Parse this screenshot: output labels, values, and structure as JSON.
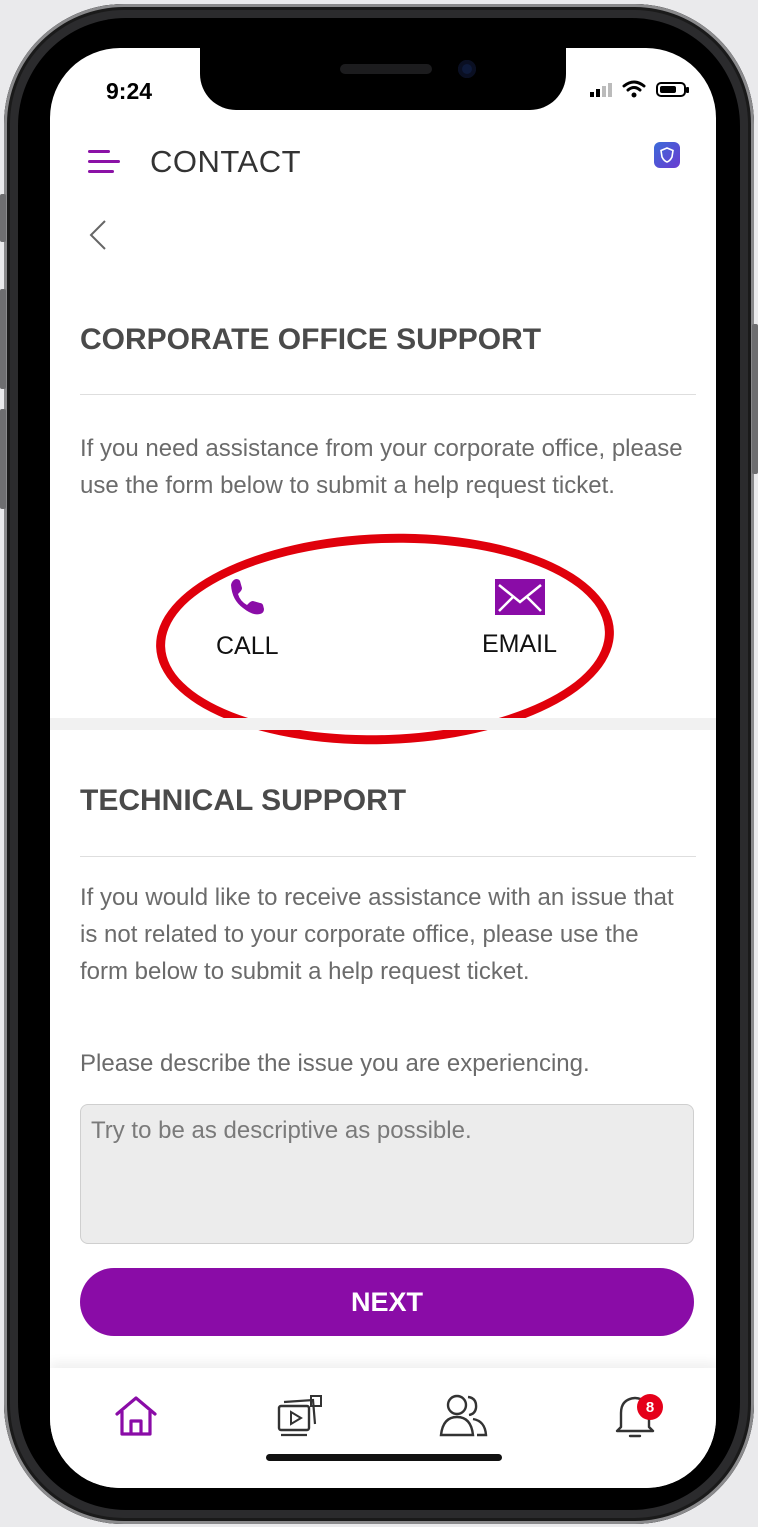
{
  "status_bar": {
    "time": "9:24"
  },
  "header": {
    "title": "CONTACT"
  },
  "corporate": {
    "heading": "CORPORATE OFFICE SUPPORT",
    "description": "If you need assistance from your corporate office, please use the form below to submit a help request ticket.",
    "call_label": "CALL",
    "email_label": "EMAIL"
  },
  "technical": {
    "heading": "TECHNICAL SUPPORT",
    "description": "If you would like to receive assistance with an issue that is not related to your corporate office, please use the form below to submit a help request ticket.",
    "prompt": "Please describe the issue you are experiencing.",
    "textarea_placeholder": "Try to be as descriptive as possible.",
    "next_label": "NEXT"
  },
  "tabbar": {
    "items": [
      {
        "icon": "home-icon",
        "active": true
      },
      {
        "icon": "media-icon",
        "active": false
      },
      {
        "icon": "people-icon",
        "active": false
      },
      {
        "icon": "bell-icon",
        "active": false
      }
    ],
    "notification_count": "8"
  },
  "colors": {
    "accent": "#8a0ca7",
    "highlight": "#e0000b",
    "badge": "#e5001a"
  }
}
